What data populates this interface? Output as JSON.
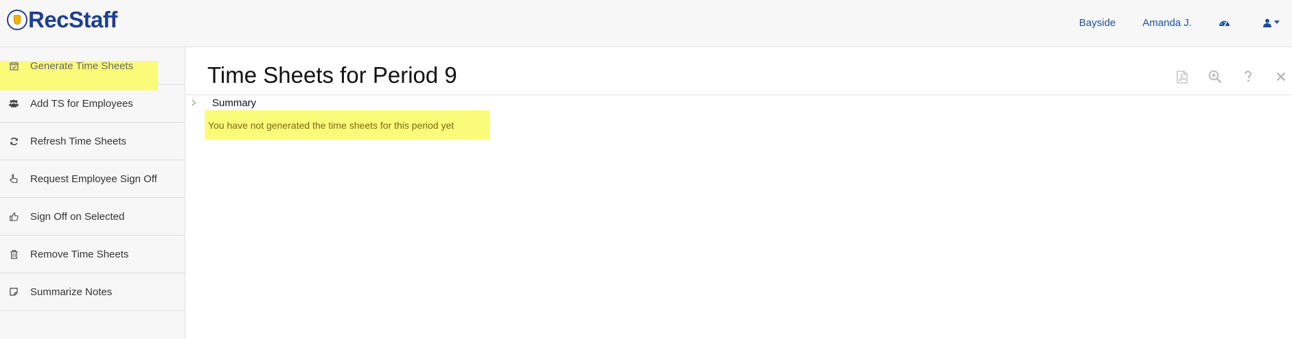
{
  "app": {
    "logo_text": "RecStaff",
    "accent": "#1f4e9c",
    "highlight": "#fbfb7a"
  },
  "topnav": {
    "location": "Bayside",
    "user_name": "Amanda J.",
    "dashboard_icon": "gauge-icon",
    "user_icon": "user-icon"
  },
  "sidebar": {
    "items": [
      {
        "label": "Generate Time Sheets",
        "icon": "calendar-check-icon",
        "active": true
      },
      {
        "label": "Add TS for Employees",
        "icon": "users-icon"
      },
      {
        "label": "Refresh Time Sheets",
        "icon": "refresh-icon"
      },
      {
        "label": "Request Employee Sign Off",
        "icon": "hand-pointer-icon"
      },
      {
        "label": "Sign Off on Selected",
        "icon": "thumbs-up-icon"
      },
      {
        "label": "Remove Time Sheets",
        "icon": "trash-icon"
      },
      {
        "label": "Summarize Notes",
        "icon": "sticky-note-icon"
      }
    ]
  },
  "main": {
    "title": "Time Sheets for Period 9",
    "tools": [
      "pdf-icon",
      "zoom-in-icon",
      "help-icon",
      "close-icon"
    ],
    "summary_label": "Summary",
    "notice": "You have not generated the time sheets for this period yet"
  }
}
